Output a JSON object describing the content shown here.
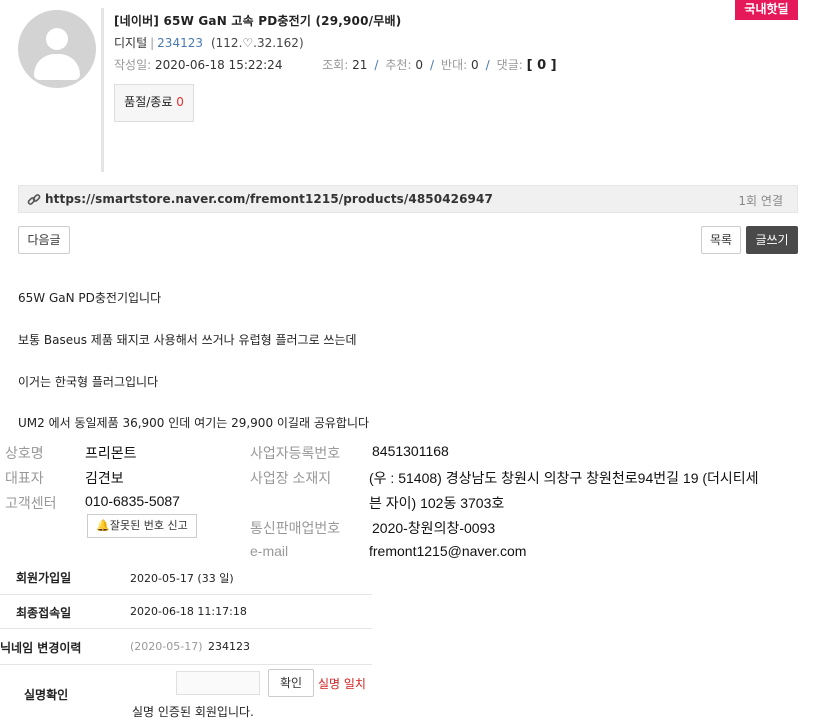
{
  "post": {
    "title": "[네이버] 65W GaN 고속 PD충전기 (29,900/무배)",
    "badge": "국내핫딜",
    "category": "디지털",
    "user_id": "234123",
    "user_score": "(112.♡.32.162)",
    "date_label": "작성일:",
    "date": "2020-06-18 15:22:24",
    "views_label": "조회:",
    "views": "21",
    "rec_label": "추천:",
    "rec": "0",
    "opp_label": "반대:",
    "opp": "0",
    "comments_label": "댓글:",
    "comments": "[ 0 ]",
    "status_label": "품절/종료",
    "status_count": "0"
  },
  "link": {
    "url": "https://smartstore.naver.com/fremont1215/products/4850426947",
    "count": "1회 연결"
  },
  "buttons": {
    "next": "다음글",
    "list": "목록",
    "write": "글쓰기"
  },
  "content": {
    "lines": [
      "65W GaN PD충전기입니다",
      "보통 Baseus 제품 돼지코 사용해서 쓰거나 유럽형 플러그로 쓰는데",
      "이거는 한국형 플러그입니다",
      "UM2 에서 동일제품 36,900 인데 여기는 29,900 이길래 공유합니다"
    ]
  },
  "seller": {
    "company_label": "상호명",
    "company": "프리몬트",
    "ceo_label": "대표자",
    "ceo": "김견보",
    "cs_label": "고객센터",
    "cs": "010-6835-5087",
    "report_btn": "잘못된 번호 신고",
    "bizno_label": "사업자등록번호",
    "bizno": "8451301168",
    "addr_label": "사업장 소재지",
    "addr_line1": "(우 : 51408) 경상남도 창원시 의창구 창원천로94번길 19 (더시티세",
    "addr_line2": "븐 자이) 102동 3703호",
    "mail_order_label": "통신판매업번호",
    "mail_order": "2020-창원의창-0093",
    "email_label": "e-mail",
    "email": "fremont1215@naver.com"
  },
  "member": {
    "join_label": "회원가입일",
    "join": "2020-05-17 (33 일)",
    "last_label": "최종접속일",
    "last": "2020-06-18 11:17:18",
    "nick_label": "닉네임 변경이력",
    "nick_date": "(2020-05-17)",
    "nick_id": "234123",
    "realname_label": "실명확인",
    "confirm_btn": "확인",
    "realname_status": "실명 일치",
    "realname_note": "실명 인증된 회원입니다."
  }
}
